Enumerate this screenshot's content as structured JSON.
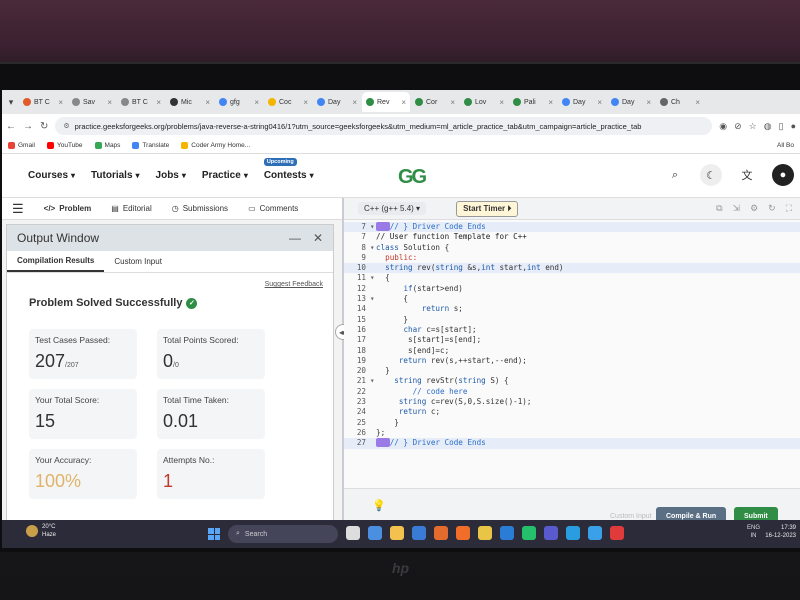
{
  "browser": {
    "tabs": [
      {
        "label": "BT C",
        "color": "#e05a2a"
      },
      {
        "label": "Sav",
        "color": "#888"
      },
      {
        "label": "BT C",
        "color": "#888"
      },
      {
        "label": "Mic",
        "color": "#333"
      },
      {
        "label": "gfg",
        "color": "#4285f4"
      },
      {
        "label": "Coc",
        "color": "#f4b400"
      },
      {
        "label": "Day",
        "color": "#4285f4"
      },
      {
        "label": "Rev",
        "color": "#2f8d46",
        "active": true
      },
      {
        "label": "Cor",
        "color": "#2f8d46"
      },
      {
        "label": "Lov",
        "color": "#2f8d46"
      },
      {
        "label": "Pali",
        "color": "#2f8d46"
      },
      {
        "label": "Day",
        "color": "#4285f4"
      },
      {
        "label": "Day",
        "color": "#4285f4"
      },
      {
        "label": "Ch",
        "color": "#666"
      }
    ],
    "url": "practice.geeksforgeeks.org/problems/java-reverse-a-string0416/1?utm_source=geeksforgeeks&utm_medium=ml_article_practice_tab&utm_campaign=article_practice_tab",
    "bookmarks": [
      {
        "label": "Gmail",
        "color": "#ea4335"
      },
      {
        "label": "YouTube",
        "color": "#ff0000"
      },
      {
        "label": "Maps",
        "color": "#34a853"
      },
      {
        "label": "Translate",
        "color": "#4285f4"
      },
      {
        "label": "Coder Army Home...",
        "color": "#f4b400"
      }
    ],
    "bookmarks_right": "All Bo"
  },
  "site": {
    "nav": [
      {
        "label": "Courses"
      },
      {
        "label": "Tutorials"
      },
      {
        "label": "Jobs"
      },
      {
        "label": "Practice"
      },
      {
        "label": "Contests",
        "badge": "Upcoming"
      }
    ],
    "logo": "GG"
  },
  "left_tabs": {
    "problem": "Problem",
    "editorial": "Editorial",
    "submissions": "Submissions",
    "comments": "Comments"
  },
  "output_window": {
    "title": "Output Window",
    "tab_results": "Compilation Results",
    "tab_custom": "Custom Input",
    "feedback": "Suggest Feedback",
    "status": "Problem Solved Successfully",
    "stats": {
      "tests_label": "Test Cases Passed:",
      "tests_value": "207",
      "tests_total": "/207",
      "points_label": "Total Points Scored:",
      "points_value": "0",
      "points_total": "/0",
      "score_label": "Your Total Score:",
      "score_value": "15",
      "time_label": "Total Time Taken:",
      "time_value": "0.01",
      "accuracy_label": "Your Accuracy:",
      "accuracy_value": "100%",
      "attempts_label": "Attempts No.:",
      "attempts_value": "1"
    }
  },
  "editor": {
    "language": "C++ (g++ 5.4)",
    "timer": "Start Timer",
    "custom_input": "Custom Input",
    "compile_run": "Compile & Run",
    "submit": "Submit"
  },
  "taskbar": {
    "weather_temp": "20°C",
    "weather_desc": "Haze",
    "search": "Search",
    "lang": "ENG",
    "region": "IN",
    "time": "17:39",
    "date": "16-12-2023"
  }
}
